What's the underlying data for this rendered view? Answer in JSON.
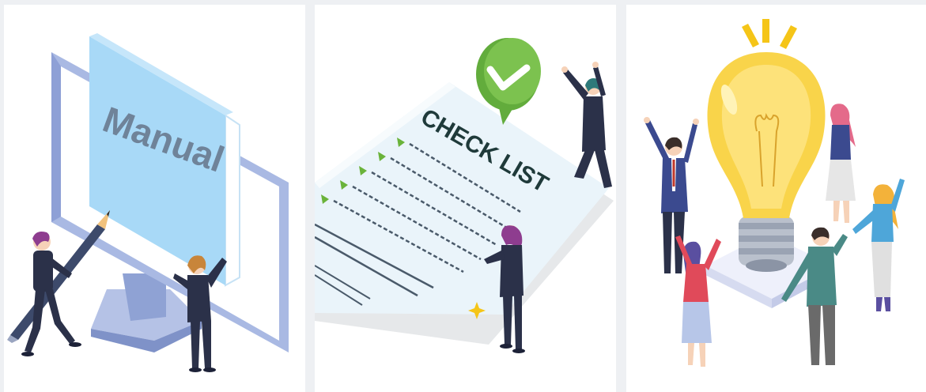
{
  "images": [
    {
      "id": "manual",
      "label": "Manual"
    },
    {
      "id": "checklist",
      "label": "CHECK LIST"
    },
    {
      "id": "idea"
    }
  ],
  "colors": {
    "page_background": "#eef0f3",
    "card_background": "#ffffff",
    "monitor_frame": "#a9b9e3",
    "book_cover": "#a8d9f7",
    "suit_navy": "#2b3149",
    "hair_purple": "#8e3d8f",
    "check_green": "#6ab33a",
    "bulb_yellow": "#f9d44a",
    "bubble_green": "#62ac3c"
  }
}
